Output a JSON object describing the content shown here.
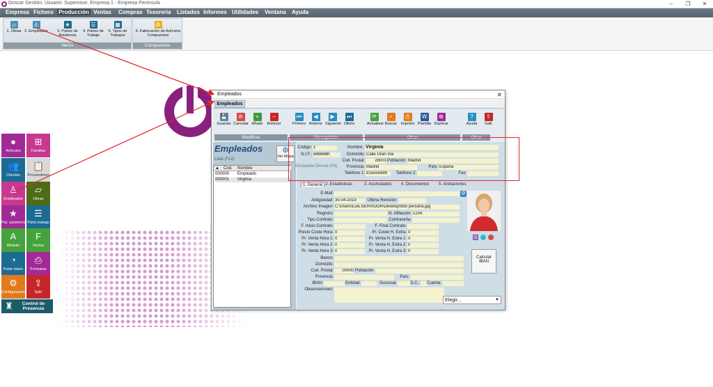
{
  "window": {
    "title": "Doscar Gestión. Usuario: Supervisor. Empresa 1 - Empresa Peninsula",
    "controls": [
      "–",
      "❐",
      "✕"
    ]
  },
  "menu": {
    "items": [
      "Empresa",
      "Fichero",
      "Producción",
      "Ventas",
      "Compras",
      "Tesorería",
      "Listados",
      "Informes",
      "Utilidades",
      "Ventana",
      "Ayuda"
    ],
    "active": "Producción"
  },
  "ribbon": {
    "groups": [
      {
        "label": "Varios",
        "buttons": [
          {
            "label": "1. Obras",
            "icon": "hammer-icon"
          },
          {
            "label": "2. Empleados",
            "icon": "worker-icon"
          },
          {
            "label": "3. Partes de Asistencia",
            "icon": "star-icon"
          },
          {
            "label": "4. Partes de Trabajo",
            "icon": "clipboard-icon"
          },
          {
            "label": "5. Tipos de Trabajos",
            "icon": "grid-icon"
          }
        ]
      },
      {
        "label": "Compuestos",
        "buttons": [
          {
            "label": "6. Fabricación de Artículos Compuestos",
            "icon": "factory-icon"
          }
        ]
      }
    ]
  },
  "tiles": [
    {
      "label": "Artículos",
      "color": "#a12a96",
      "icon": "articles-icon",
      "glyph": "●"
    },
    {
      "label": "Familias",
      "color": "#c7388f",
      "icon": "tree-icon",
      "glyph": "⊞"
    },
    {
      "label": "Clientes",
      "color": "#1c6b92",
      "icon": "clients-icon",
      "glyph": "👥"
    },
    {
      "label": "Proveedores",
      "color": "#d7d8d9",
      "icon": "supplier-icon",
      "glyph": "📋"
    },
    {
      "label": "Empleados",
      "color": "#c7388f",
      "icon": "worker-icon",
      "glyph": "♙"
    },
    {
      "label": "Obras",
      "color": "#4e6c17",
      "icon": "hammer-icon",
      "glyph": "▱"
    },
    {
      "label": "Par. asistencia",
      "color": "#a12a96",
      "icon": "star-icon",
      "glyph": "★"
    },
    {
      "label": "Parte trabajo",
      "color": "#1c6b92",
      "icon": "clipboard-icon",
      "glyph": "☰"
    },
    {
      "label": "Albarán",
      "color": "#46a23b",
      "icon": "delivery-note-icon",
      "glyph": "A"
    },
    {
      "label": "Ventas",
      "color": "#46a23b",
      "icon": "sales-icon",
      "glyph": "F"
    },
    {
      "label": "Parte diario",
      "color": "#1c6b92",
      "icon": "pie-chart-icon",
      "glyph": "◔"
    },
    {
      "label": "Formatos",
      "color": "#a12a96",
      "icon": "printer-icon",
      "glyph": "⎙"
    },
    {
      "label": "Configuración",
      "color": "#e07a1b",
      "icon": "gear-icon",
      "glyph": "⚙"
    },
    {
      "label": "Salir",
      "color": "#c6262a",
      "icon": "exit-icon",
      "glyph": "⇪"
    },
    {
      "label": "Control de Presencia",
      "color": "#1b5c6a",
      "icon": "presence-icon",
      "glyph": "♜"
    }
  ],
  "dialog": {
    "title": "Empleados",
    "tab": "Empleados",
    "toolbar": {
      "groups": [
        {
          "label": "Modificar",
          "buttons": [
            {
              "label": "Guardar",
              "color": "#4e8fb7",
              "glyph": "💾"
            },
            {
              "label": "Cancelar",
              "color": "#d94848",
              "glyph": "⊘"
            },
            {
              "label": "Añadir",
              "color": "#3e9b3b",
              "glyph": "+"
            },
            {
              "label": "Eliminar",
              "color": "#c6262a",
              "glyph": "−"
            }
          ]
        },
        {
          "label": "Navegación",
          "buttons": [
            {
              "label": "Primero",
              "color": "#2a8fc0",
              "glyph": "⏮"
            },
            {
              "label": "Anterior",
              "color": "#2a8fc0",
              "glyph": "◀"
            },
            {
              "label": "Siguiente",
              "color": "#2a8fc0",
              "glyph": "▶"
            },
            {
              "label": "Último",
              "color": "#1c6b92",
              "glyph": "⏭"
            }
          ]
        },
        {
          "label": "Otros",
          "buttons": [
            {
              "label": "Actualizar",
              "color": "#46a23b",
              "glyph": "⟳"
            },
            {
              "label": "Buscar",
              "color": "#e07a1b",
              "glyph": "⌕"
            },
            {
              "label": "Imprimir",
              "color": "#e07a1b",
              "glyph": "⎙"
            },
            {
              "label": "Plantilla",
              "color": "#2b5797",
              "glyph": "W"
            },
            {
              "label": "Duplicar",
              "color": "#a12a96",
              "glyph": "⧉"
            }
          ]
        },
        {
          "label": "Otros",
          "buttons": [
            {
              "label": "Ayuda",
              "color": "#2a8fc0",
              "glyph": "?"
            },
            {
              "label": "Salir",
              "color": "#c6262a",
              "glyph": "⇪"
            }
          ]
        }
      ]
    },
    "left": {
      "heading": "Empleados",
      "subtitle": "Lista (F12)",
      "quick_search": "Búsqueda Directa (F6)",
      "map_button": "Ver Mapa",
      "columns": [
        "Cod.",
        "Nombre"
      ],
      "rows": [
        [
          "000000",
          "Empleado"
        ],
        [
          "000001",
          "Virginia"
        ]
      ]
    },
    "record": {
      "codigo_label": "Código:",
      "codigo": "1",
      "nombre_label": "Nombre:",
      "nombre": "Virginia",
      "nif_label": "N.I.F.:",
      "nif": "888888K",
      "domicilio_label": "Domicilio:",
      "domicilio": "Calle Gran Via",
      "cp_label": "Cod. Postal:",
      "cp": "28001",
      "poblacion_label": "Población:",
      "poblacion": "Madrid",
      "provincia_label": "Provincia:",
      "provincia": "Madrid",
      "pais_label": "País:",
      "pais": "España",
      "tel1_label": "Teléfono 1:",
      "tel1": "915555999",
      "tel2_label": "Teléfono 2:",
      "tel2": "",
      "fax_label": "Fax:",
      "fax": ""
    },
    "subtabs": [
      "1. General",
      "2. Estadísticas",
      "3. Acumulados",
      "4. Documentos",
      "5. Anotaciones"
    ],
    "general": {
      "email_label": "E-Mail:",
      "antiguedad_label": "Antigüedad:",
      "antiguedad": "30-04-2019",
      "ultima_revision_label": "Última Revisión:",
      "archivo_label": "Archivo Imagen:",
      "archivo": "C:\\Users\\Luis.SERVIDOR\\Desktop\\foto persona.jpg",
      "registro_label": "Registro:",
      "afiliacion_label": "N. Afiliación:",
      "afiliacion": "1234",
      "tipo_contrato_label": "Tipo Contrato:",
      "contrasena_label": "Contraseña:",
      "f_inicio_label": "F. Inicio Contrato:",
      "f_final_label": "F. Final Contrato:",
      "precio_coste_hora_label": "Precio Coste Hora:",
      "precio_coste_hora": "0",
      "pr_coste_h_extra_label": "Pr. Coste H. Extra:",
      "pr_coste_h_extra": "0",
      "pr_venta_1_label": "Pr. Venta Hora 1:",
      "pr_venta_1": "0",
      "pr_venta_ex1_label": "Pr. Venta H. Extra 1:",
      "pr_venta_ex1": "0",
      "pr_venta_2_label": "Pr. Venta Hora 2:",
      "pr_venta_2": "0",
      "pr_venta_ex2_label": "Pr. Venta H. Extra 2:",
      "pr_venta_ex2": "0",
      "pr_venta_3_label": "Pr. Venta Hora 3:",
      "pr_venta_3": "0",
      "pr_venta_ex3_label": "Pr. Venta H. Extra 3:",
      "pr_venta_ex3": "0",
      "banco_label": "Banco:",
      "domicilio2_label": "Domicilio:",
      "cp2_label": "Cod. Postal:",
      "cp2": "00000",
      "poblacion2_label": "Población:",
      "provincia2_label": "Provincia:",
      "pais2_label": "País:",
      "iban_label": "IBAN:",
      "entidad_label": "Entidad:",
      "sucursal_label": "Sucursal:",
      "dc_label": "D.C.:",
      "cuenta_label": "Cuenta:",
      "observaciones_label": "Observaciones:",
      "calc_iban": "Calcular IBAN",
      "elegir": "Elegir..."
    },
    "close_glyph": "✕"
  },
  "colors": {
    "accent": "#8a1f7d",
    "highlight": "#e0262b",
    "field": "#f4f2cf",
    "panel": "#cfdde6"
  }
}
